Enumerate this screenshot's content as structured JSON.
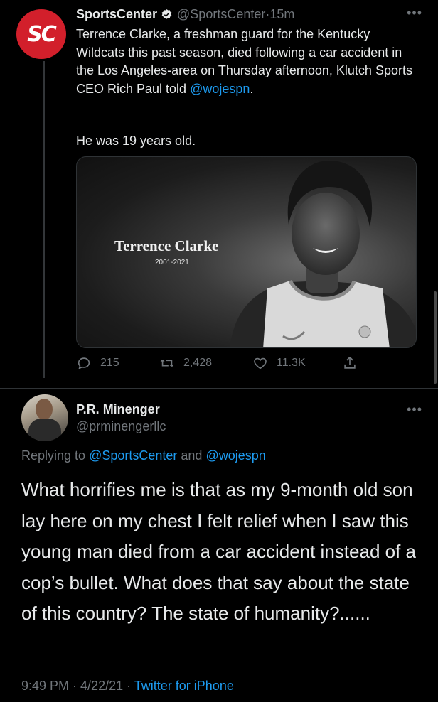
{
  "tweet": {
    "author_name": "SportsCenter",
    "author_handle": "@SportsCenter",
    "time_sep": " · ",
    "time": "15m",
    "avatar_text": "SC",
    "text_part1": "Terrence Clarke, a freshman guard for the Kentucky Wildcats this past season, died following a car accident in the Los Angeles-area on Thursday afternoon, Klutch Sports CEO Rich Paul told ",
    "mention": "@wojespn",
    "text_part2": ".",
    "text_line2": "He was 19 years old.",
    "media": {
      "name": "Terrence Clarke",
      "years": "2001-2021"
    },
    "replies": "215",
    "retweets": "2,428",
    "likes": "11.3K"
  },
  "reply": {
    "author_name": "P.R. Minenger",
    "author_handle": "@prminengerllc",
    "replying_prefix": "Replying to ",
    "replying_to_1": "@SportsCenter",
    "replying_and": " and ",
    "replying_to_2": "@wojespn",
    "text": "What horrifies me is that as my 9-month old son lay here on my chest I felt relief when I saw this young man died from a car accident instead of a cop’s bullet. What does that say about the state of this country? The state of humanity?......",
    "time": "9:49 PM",
    "date": "4/22/21",
    "sep": " · ",
    "source": "Twitter for iPhone"
  },
  "colors": {
    "background": "#000000",
    "accent": "#1d9bf0",
    "muted": "#71767b",
    "espn_red": "#d21f2b"
  },
  "icons": [
    "reply-icon",
    "retweet-icon",
    "like-icon",
    "share-icon",
    "verified-icon",
    "more-icon"
  ]
}
